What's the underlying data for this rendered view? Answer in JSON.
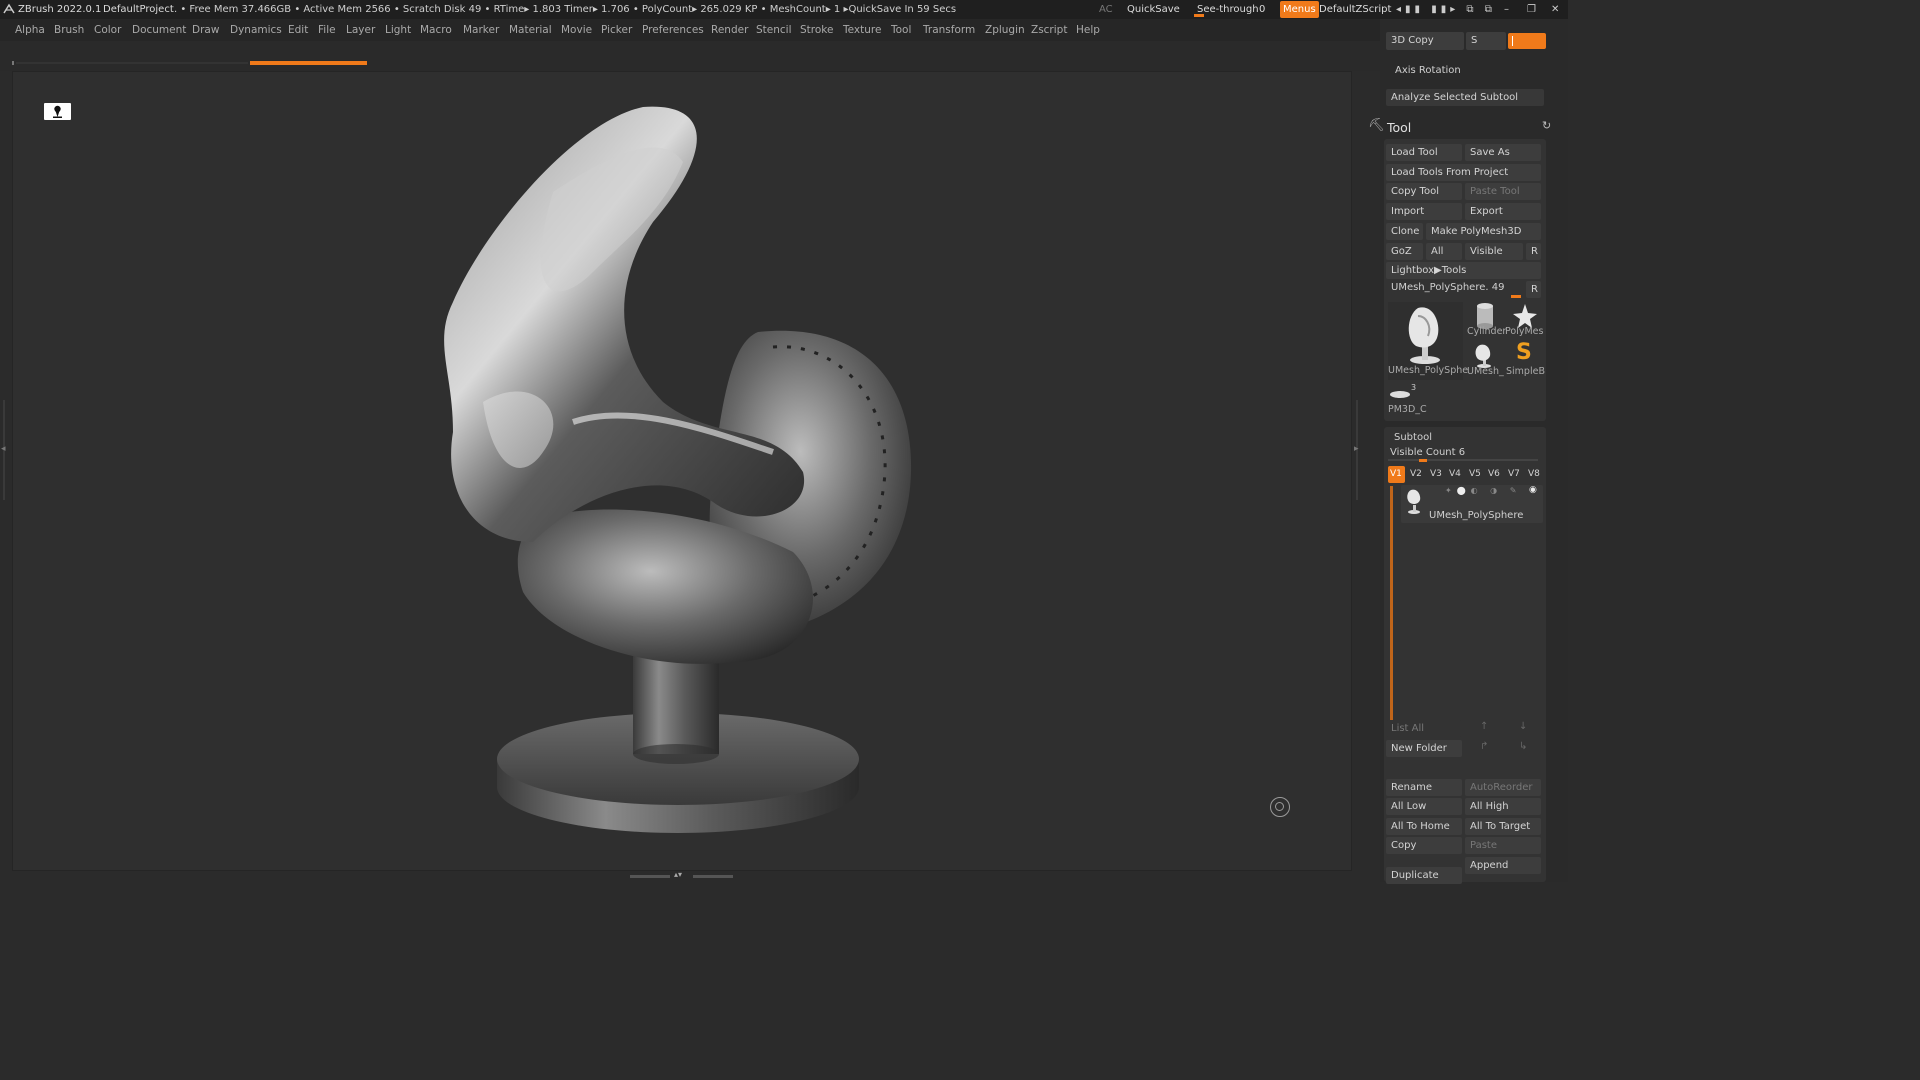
{
  "titlebar": {
    "app": "ZBrush 2022.0.1",
    "project": "DefaultProject",
    "stats": ". • Free Mem 37.466GB • Active Mem 2566 • Scratch Disk 49 •  RTime▸ 1.803 Timer▸ 1.706 • PolyCount▸ 265.029 KP  • MeshCount▸ 1   ▸QuickSave In 59 Secs",
    "ac": "AC",
    "quicksave": "QuickSave",
    "seethrough_label": "See-through",
    "seethrough_value": "0",
    "menus": "Menus",
    "script": "DefaultZScript"
  },
  "menubar": [
    "Alpha",
    "Brush",
    "Color",
    "Document",
    "Draw",
    "Dynamics",
    "Edit",
    "File",
    "Layer",
    "Light",
    "Macro",
    "Marker",
    "Material",
    "Movie",
    "Picker",
    "Preferences",
    "Render",
    "Stencil",
    "Stroke",
    "Texture",
    "Tool",
    "Transform",
    "Zplugin",
    "Zscript",
    "Help"
  ],
  "colors": {
    "accent": "#f07a1a",
    "bg": "#2b2b2b",
    "panel": "#353535",
    "button": "#3d3d3d"
  },
  "rightpanel": {
    "copy3d": "3D Copy",
    "copy3d_s": "S",
    "axis_rotation": "Axis Rotation",
    "analyze": "Analyze Selected Subtool",
    "tool_title": "Tool",
    "load_tool": "Load Tool",
    "save_as": "Save As",
    "load_from_project": "Load Tools From Project",
    "copy_tool": "Copy Tool",
    "paste_tool": "Paste Tool",
    "import": "Import",
    "export": "Export",
    "clone": "Clone",
    "make_polymesh": "Make PolyMesh3D",
    "goz": "GoZ",
    "all": "All",
    "visible": "Visible",
    "r": "R",
    "lightbox_tools": "Lightbox▶Tools",
    "current_tool": "UMesh_PolySphere. 49",
    "thumbs": {
      "main": "UMesh_PolySphe",
      "cylinder": "Cylinder",
      "polymesh": "PolyMes",
      "umesh": "UMesh_",
      "simpleb": "SimpleB",
      "pm3d": "PM3D_C",
      "pm3d_count": "3"
    },
    "subtool_title": "Subtool",
    "visible_count": "Visible Count 6",
    "versions": [
      "V1",
      "V2",
      "V3",
      "V4",
      "V5",
      "V6",
      "V7",
      "V8"
    ],
    "subtool_name": "UMesh_PolySphere",
    "list_all": "List All",
    "new_folder": "New Folder",
    "rename": "Rename",
    "autoreorder": "AutoReorder",
    "all_low": "All Low",
    "all_high": "All High",
    "all_to_home": "All To Home",
    "all_to_target": "All To Target",
    "copy": "Copy",
    "paste": "Paste",
    "append": "Append",
    "duplicate": "Duplicate"
  }
}
